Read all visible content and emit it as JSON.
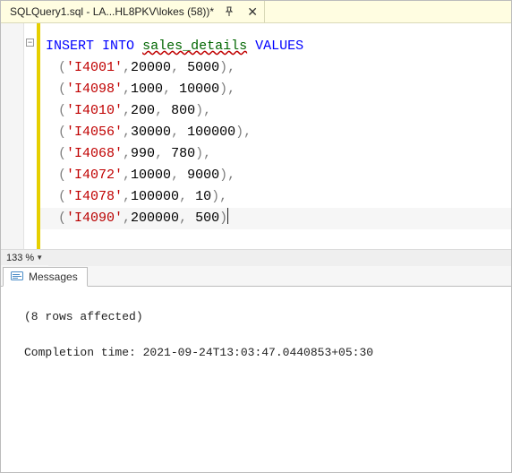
{
  "tab": {
    "title": "SQLQuery1.sql - LA...HL8PKV\\lokes (58))*",
    "dirty_mark": "*"
  },
  "editor": {
    "zoom_label": "133 %",
    "active_line_index": 7,
    "sql": {
      "keyword1": "INSERT",
      "keyword2": "INTO",
      "table": "sales_details",
      "keyword3": "VALUES",
      "rows": [
        {
          "id": "I4001",
          "v1": "20000",
          "v2": "5000",
          "sep": ","
        },
        {
          "id": "I4098",
          "v1": "1000",
          "v2": "10000",
          "sep": ","
        },
        {
          "id": "I4010",
          "v1": "200",
          "v2": "800",
          "sep": ","
        },
        {
          "id": "I4056",
          "v1": "30000",
          "v2": "100000",
          "sep": ","
        },
        {
          "id": "I4068",
          "v1": "990",
          "v2": "780",
          "sep": ","
        },
        {
          "id": "I4072",
          "v1": "10000",
          "v2": "9000",
          "sep": ","
        },
        {
          "id": "I4078",
          "v1": "100000",
          "v2": "10",
          "sep": ","
        },
        {
          "id": "I4090",
          "v1": "200000",
          "v2": "500",
          "sep": ""
        }
      ]
    }
  },
  "messages": {
    "tab_label": "Messages",
    "line1": "(8 rows affected)",
    "line2": "Completion time: 2021-09-24T13:03:47.0440853+05:30"
  }
}
